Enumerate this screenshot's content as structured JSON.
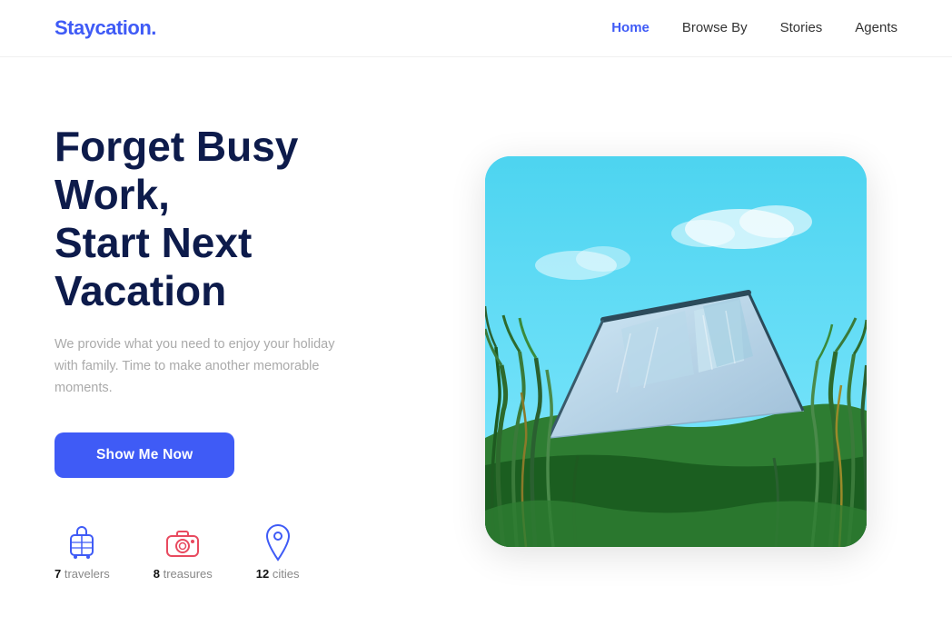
{
  "navbar": {
    "logo_prefix": "Stay",
    "logo_suffix": "cation.",
    "links": [
      {
        "label": "Home",
        "active": true
      },
      {
        "label": "Browse By",
        "active": false
      },
      {
        "label": "Stories",
        "active": false
      },
      {
        "label": "Agents",
        "active": false
      }
    ]
  },
  "hero": {
    "title_line1": "Forget Busy Work,",
    "title_line2": "Start Next Vacation",
    "subtitle": "We provide what you need to enjoy your holiday with family. Time to make another memorable moments.",
    "cta_button": "Show Me Now"
  },
  "stats": [
    {
      "count": "7",
      "label": "travelers",
      "icon": "luggage-icon"
    },
    {
      "count": "8",
      "label": "treasures",
      "icon": "camera-icon"
    },
    {
      "count": "12",
      "label": "cities",
      "icon": "location-icon"
    }
  ],
  "colors": {
    "brand_blue": "#3f5bf6",
    "dark_navy": "#0d1b4b",
    "text_gray": "#aaaaaa",
    "stat_red": "#e84a5f",
    "stat_blue": "#3f5bf6"
  }
}
